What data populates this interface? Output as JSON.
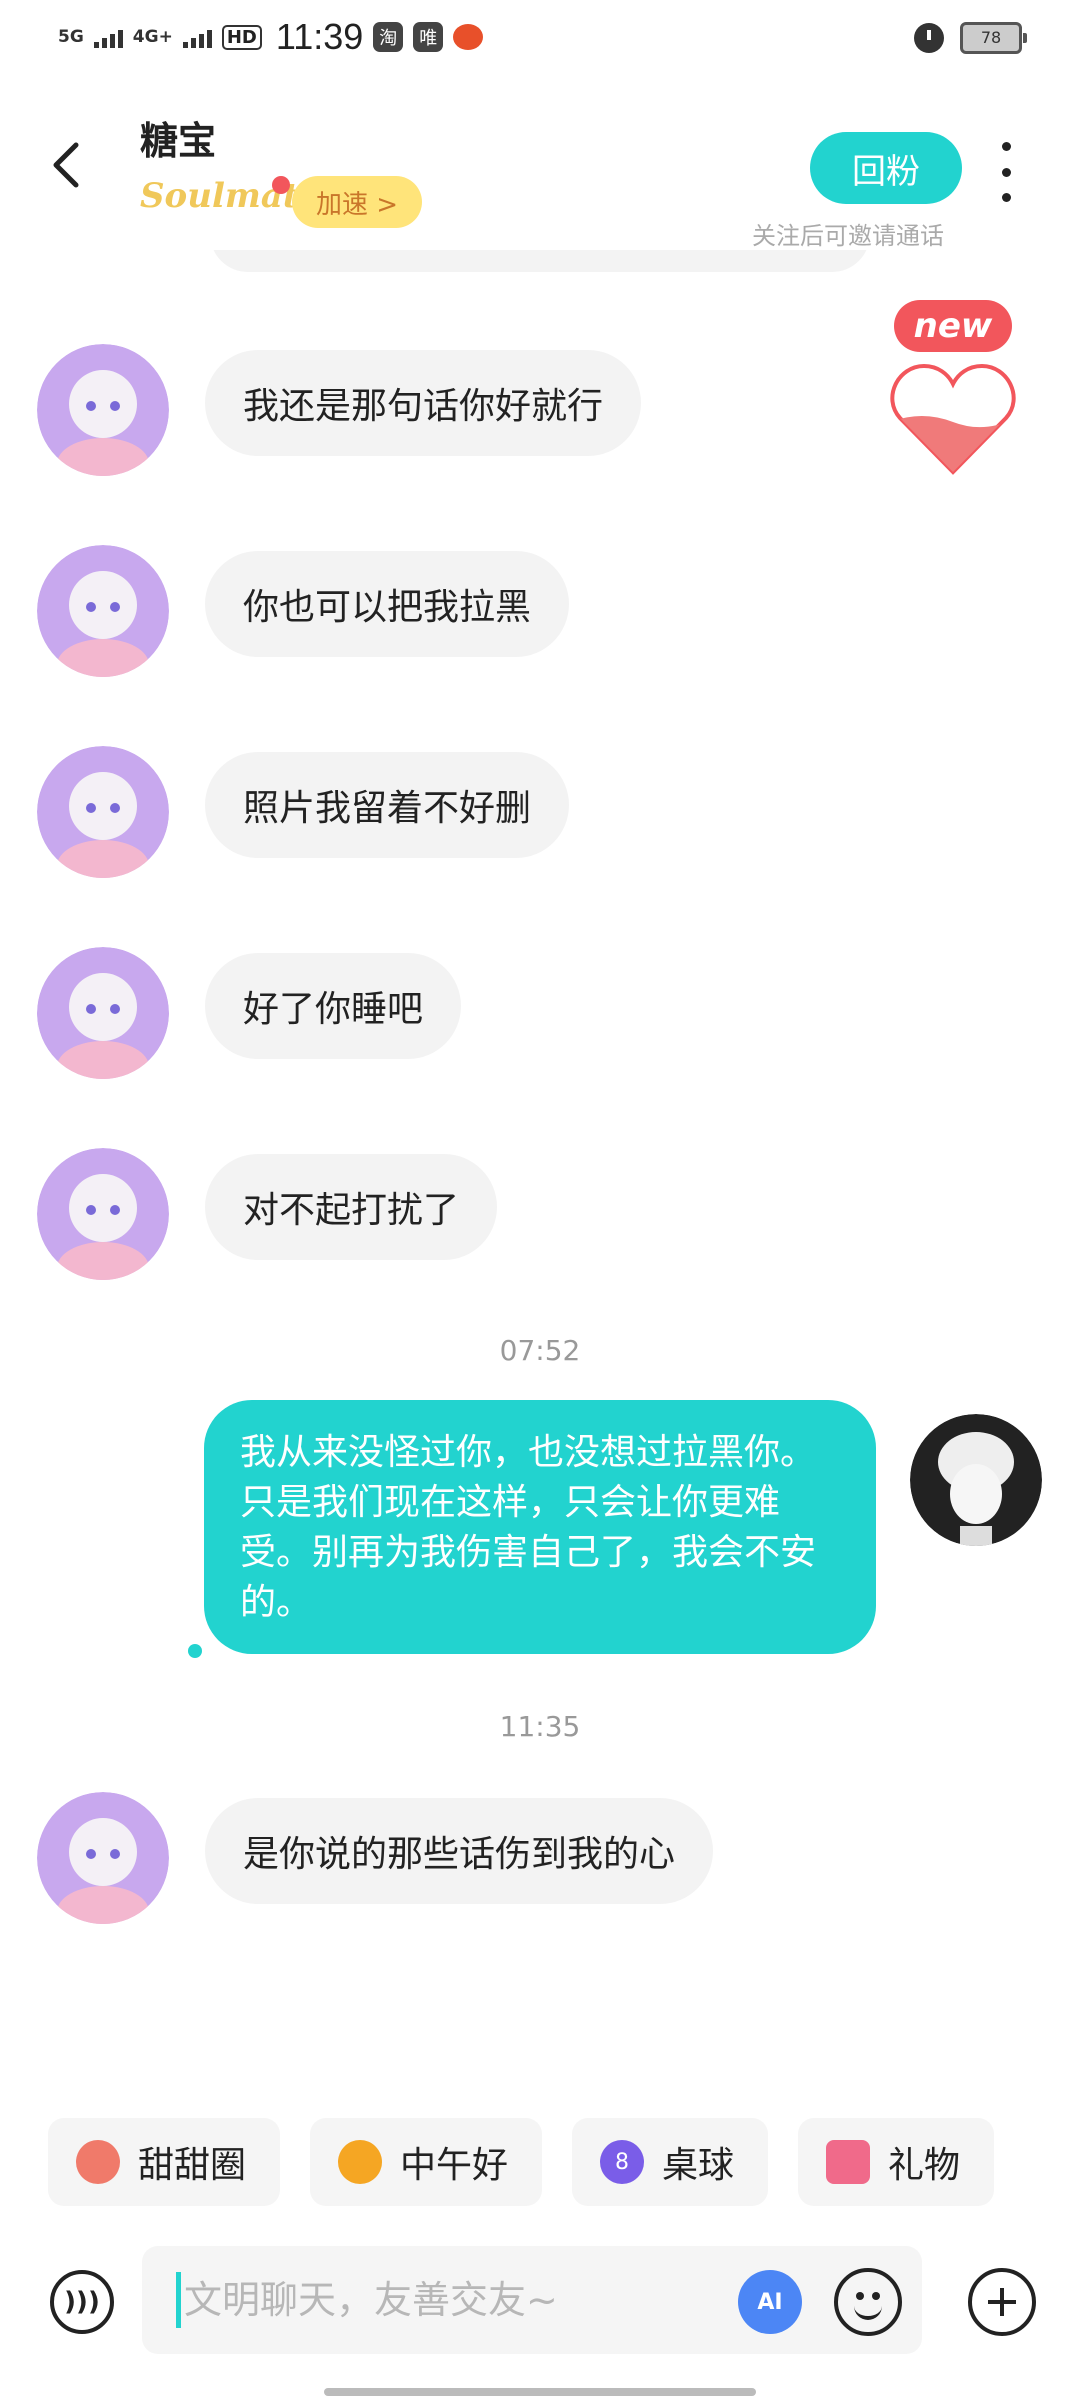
{
  "status_bar": {
    "network1": "5G",
    "network2": "4G+",
    "hd": "HD",
    "time": "11:39",
    "app_icon_1": "淘",
    "app_icon_2": "唯",
    "battery": "78"
  },
  "header": {
    "title": "糖宝",
    "soulmate_label": "Soulmate",
    "speed_label": "加速 >",
    "follow_back": "回粉",
    "hint": "关注后可邀请通话",
    "badge_new": "new"
  },
  "messages": [
    {
      "from": "other",
      "text": "我还是那句话你好就行"
    },
    {
      "from": "other",
      "text": "你也可以把我拉黑"
    },
    {
      "from": "other",
      "text": "照片我留着不好删"
    },
    {
      "from": "other",
      "text": "好了你睡吧"
    },
    {
      "from": "other",
      "text": "对不起打扰了"
    },
    {
      "from": "self",
      "text": "我从来没怪过你，也没想过拉黑你。只是我们现在这样，只会让你更难受。别再为我伤害自己了，我会不安的。"
    },
    {
      "from": "other",
      "text": "是你说的那些话伤到我的心"
    }
  ],
  "timestamps": [
    "07:52",
    "11:35"
  ],
  "quick_chips": [
    {
      "icon": "donut-icon",
      "label": "甜甜圈"
    },
    {
      "icon": "sun-sunglasses-icon",
      "label": "中午好"
    },
    {
      "icon": "billiard-ball-icon",
      "label": "桌球"
    },
    {
      "icon": "gift-icon",
      "label": "礼物"
    }
  ],
  "input": {
    "placeholder": "文明聊天，友善交友~",
    "ai_label": "AI"
  },
  "colors": {
    "accent": "#22d3cf",
    "speed_bg": "#ffe47a",
    "badge_red": "#f2565c",
    "bubble_in": "#f3f3f3"
  }
}
